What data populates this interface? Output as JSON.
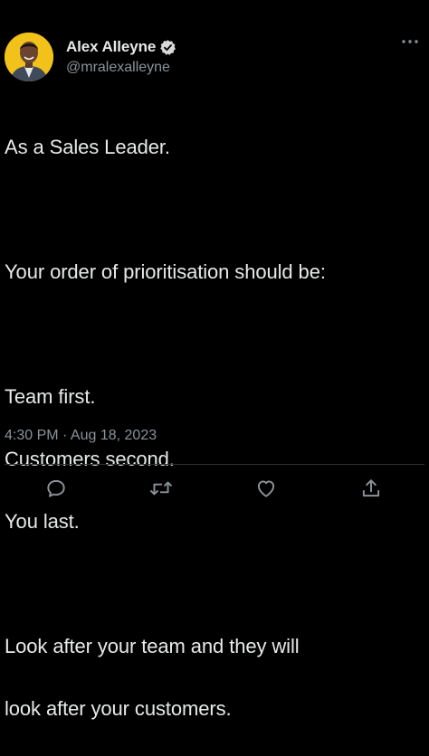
{
  "tweet": {
    "author": {
      "display_name": "Alex Alleyne",
      "handle": "@mralexalleyne",
      "verified": true,
      "avatar_background": "#f2c21a"
    },
    "text_lines": [
      "As a Sales Leader.",
      "",
      "Your order of prioritisation should be:",
      "",
      "Team first.",
      "Customers second.",
      "You last.",
      "",
      "Look after your team and they will",
      "look after your customers."
    ],
    "timestamp": "4:30 PM · Aug 18, 2023"
  },
  "icons": {
    "more": "more-horizontal-icon",
    "verified": "verified-badge-icon",
    "reply": "reply-icon",
    "retweet": "retweet-icon",
    "like": "heart-icon",
    "share": "share-icon"
  },
  "colors": {
    "background": "#000000",
    "text_primary": "#e7e9ea",
    "text_secondary": "#8b9298",
    "divider": "#2f3336"
  }
}
